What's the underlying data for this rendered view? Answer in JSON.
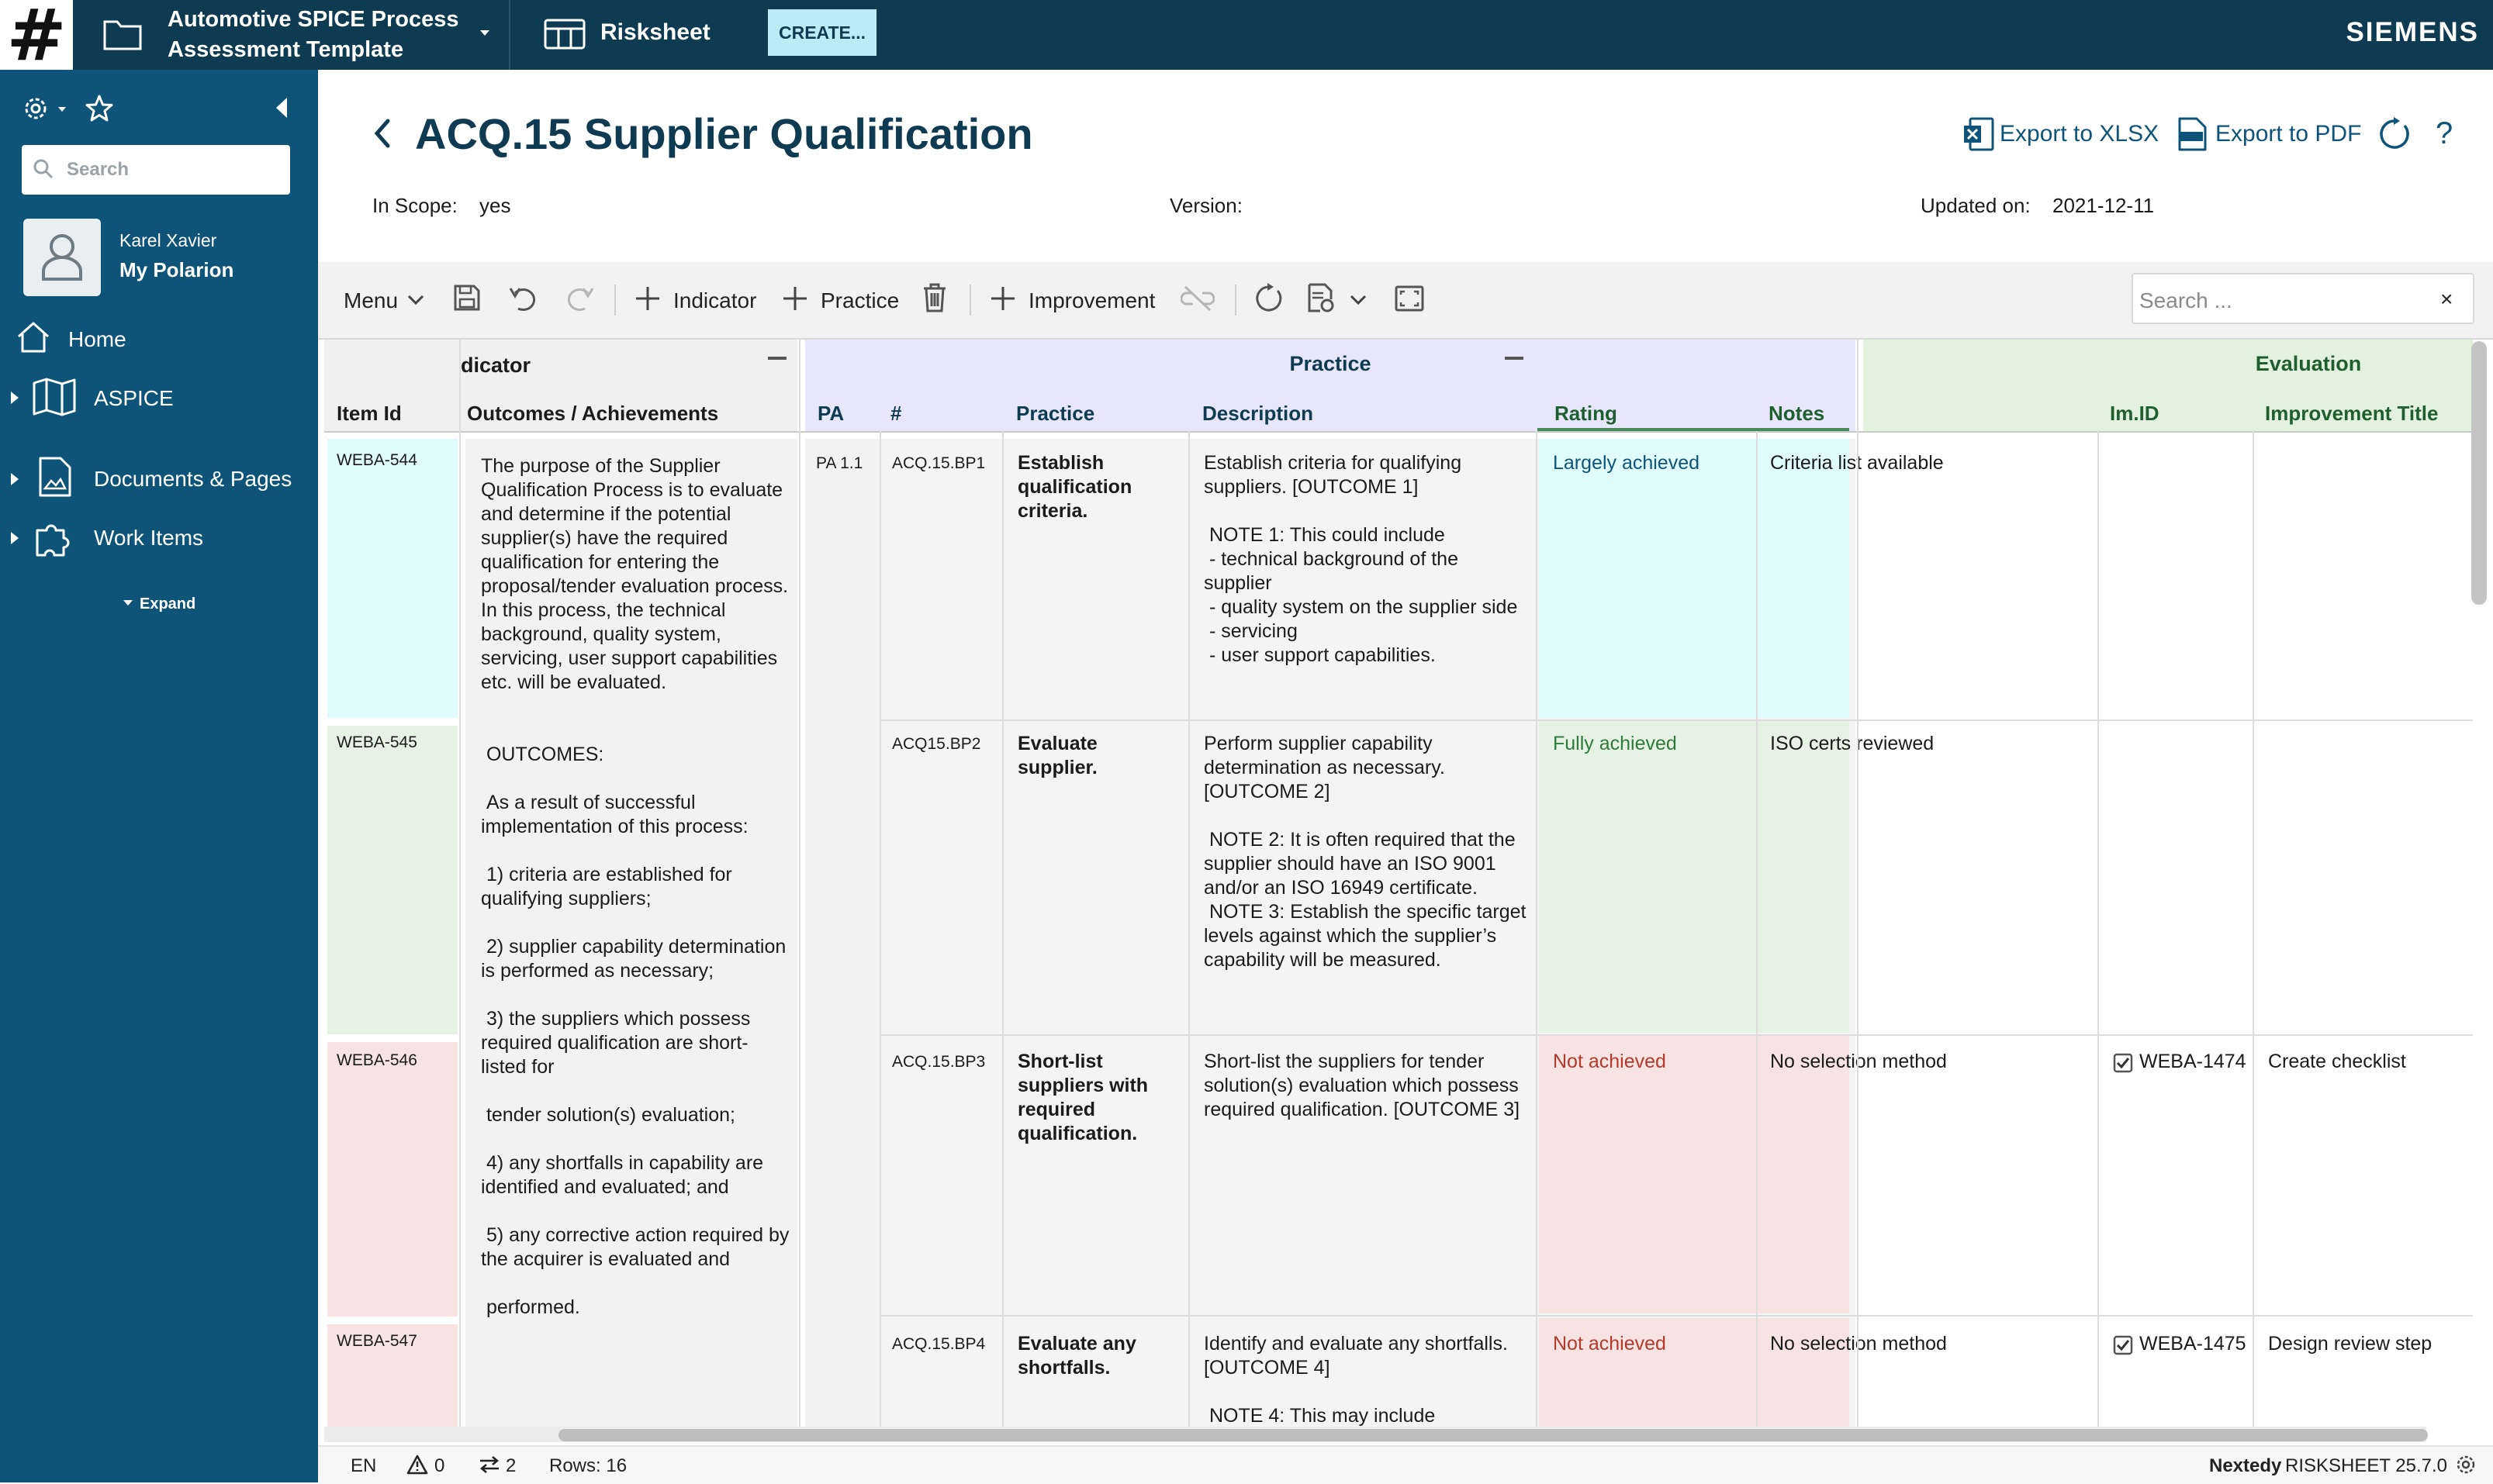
{
  "topbar": {
    "logo_glyph": "#",
    "project_title": "Automotive SPICE Process Assessment Template",
    "risksheet_label": "Risksheet",
    "create_label": "CREATE...",
    "brand": "SIEMENS"
  },
  "sidebar": {
    "search_placeholder": "Search",
    "user_name": "Karel Xavier",
    "user_link": "My Polarion",
    "nav": [
      {
        "label": "Home",
        "icon": "home-icon"
      },
      {
        "label": "ASPICE",
        "icon": "map-icon"
      },
      {
        "label": "Documents & Pages",
        "icon": "document-image-icon"
      },
      {
        "label": "Work Items",
        "icon": "puzzle-icon"
      }
    ],
    "expand_label": "Expand"
  },
  "header": {
    "title": "ACQ.15 Supplier Qualification",
    "in_scope_label": "In Scope:",
    "in_scope_value": "yes",
    "version_label": "Version:",
    "version_value": "",
    "updated_label": "Updated on:",
    "updated_value": "2021-12-11",
    "export_xlsx": "Export to XLSX",
    "export_pdf": "Export to PDF",
    "help_glyph": "?"
  },
  "toolbar": {
    "menu_label": "Menu",
    "indicator_label": "Indicator",
    "practice_label": "Practice",
    "improvement_label": "Improvement",
    "search_placeholder": "Search ...",
    "search_clear": "×"
  },
  "grid": {
    "groups": {
      "indicator": "Indicator",
      "practice": "Practice",
      "evaluation": "Evaluation"
    },
    "columns": {
      "item_id": "Item Id",
      "outcomes": "Outcomes / Achievements",
      "pa": "PA",
      "num": "#",
      "practice": "Practice",
      "description": "Description",
      "rating": "Rating",
      "notes": "Notes",
      "im_id": "Im.ID",
      "improvement_title": "Improvement Title"
    },
    "outcomes_text": "The purpose of the Supplier Qualification Process is to evaluate and determine if the potential supplier(s) have the required qualification for entering the proposal/tender evaluation process. In this process, the technical background, quality system, servicing, user support capabilities etc. will be evaluated.\n\n\n OUTCOMES:\n\n As a result of successful implementation of this process:\n\n 1) criteria are established for qualifying suppliers;\n\n 2) supplier capability determination is performed as necessary;\n\n 3) the suppliers which possess required qualification are short-listed for\n\n tender solution(s) evaluation;\n\n 4) any shortfalls in capability are identified and evaluated; and\n\n 5) any corrective action required by the acquirer is evaluated and\n\n performed.",
    "pa_value": "PA 1.1",
    "rows": [
      {
        "item_id": "WEBA-544",
        "num": "ACQ.15.BP1",
        "practice": "Establish qualification criteria.",
        "description": "Establish criteria for qualifying suppliers. [OUTCOME 1]\n\n NOTE 1: This could include\n - technical background of the supplier\n - quality system on the supplier side\n - servicing\n - user support capabilities.",
        "rating": "Largely achieved",
        "notes": "Criteria list available",
        "im_id": "",
        "improvement_title": ""
      },
      {
        "item_id": "WEBA-545",
        "num": "ACQ15.BP2",
        "practice": "Evaluate supplier.",
        "description": "Perform supplier capability determination as necessary. [OUTCOME 2]\n\n NOTE 2: It is often required that the supplier should have an ISO 9001 and/or an ISO 16949 certificate.\n NOTE 3: Establish the specific target levels against which the supplier’s capability will be measured.",
        "rating": "Fully achieved",
        "notes": "ISO certs reviewed",
        "im_id": "",
        "improvement_title": ""
      },
      {
        "item_id": "WEBA-546",
        "num": "ACQ.15.BP3",
        "practice": "Short-list suppliers with required qualification.",
        "description": "Short-list the suppliers for tender solution(s) evaluation which possess required qualification. [OUTCOME 3]",
        "rating": "Not achieved",
        "notes": "No selection method",
        "im_id": "WEBA-1474",
        "improvement_title": "Create checklist"
      },
      {
        "item_id": "WEBA-547",
        "num": "ACQ.15.BP4",
        "practice": "Evaluate any shortfalls.",
        "description": "Identify and evaluate any shortfalls. [OUTCOME 4]\n\n NOTE 4: This may include",
        "rating": "Not achieved",
        "notes": "No selection method",
        "im_id": "WEBA-1475",
        "improvement_title": "Design review step"
      }
    ]
  },
  "status": {
    "lang": "EN",
    "warnings": "0",
    "links": "2",
    "rows_label": "Rows: 16",
    "brand_bold": "Nextedy",
    "brand_rest": "RISKSHEET 25.7.0"
  },
  "colors": {
    "topbar": "#0e3b52",
    "sidebar": "#0e5478",
    "accent": "#b9ecf6",
    "rating_largely": "#e0fbfc",
    "rating_fully": "#e6f2e3",
    "rating_not": "#f7e4e2",
    "practice_header": "#e7e6fb",
    "evaluation_header": "#e3f2df"
  }
}
